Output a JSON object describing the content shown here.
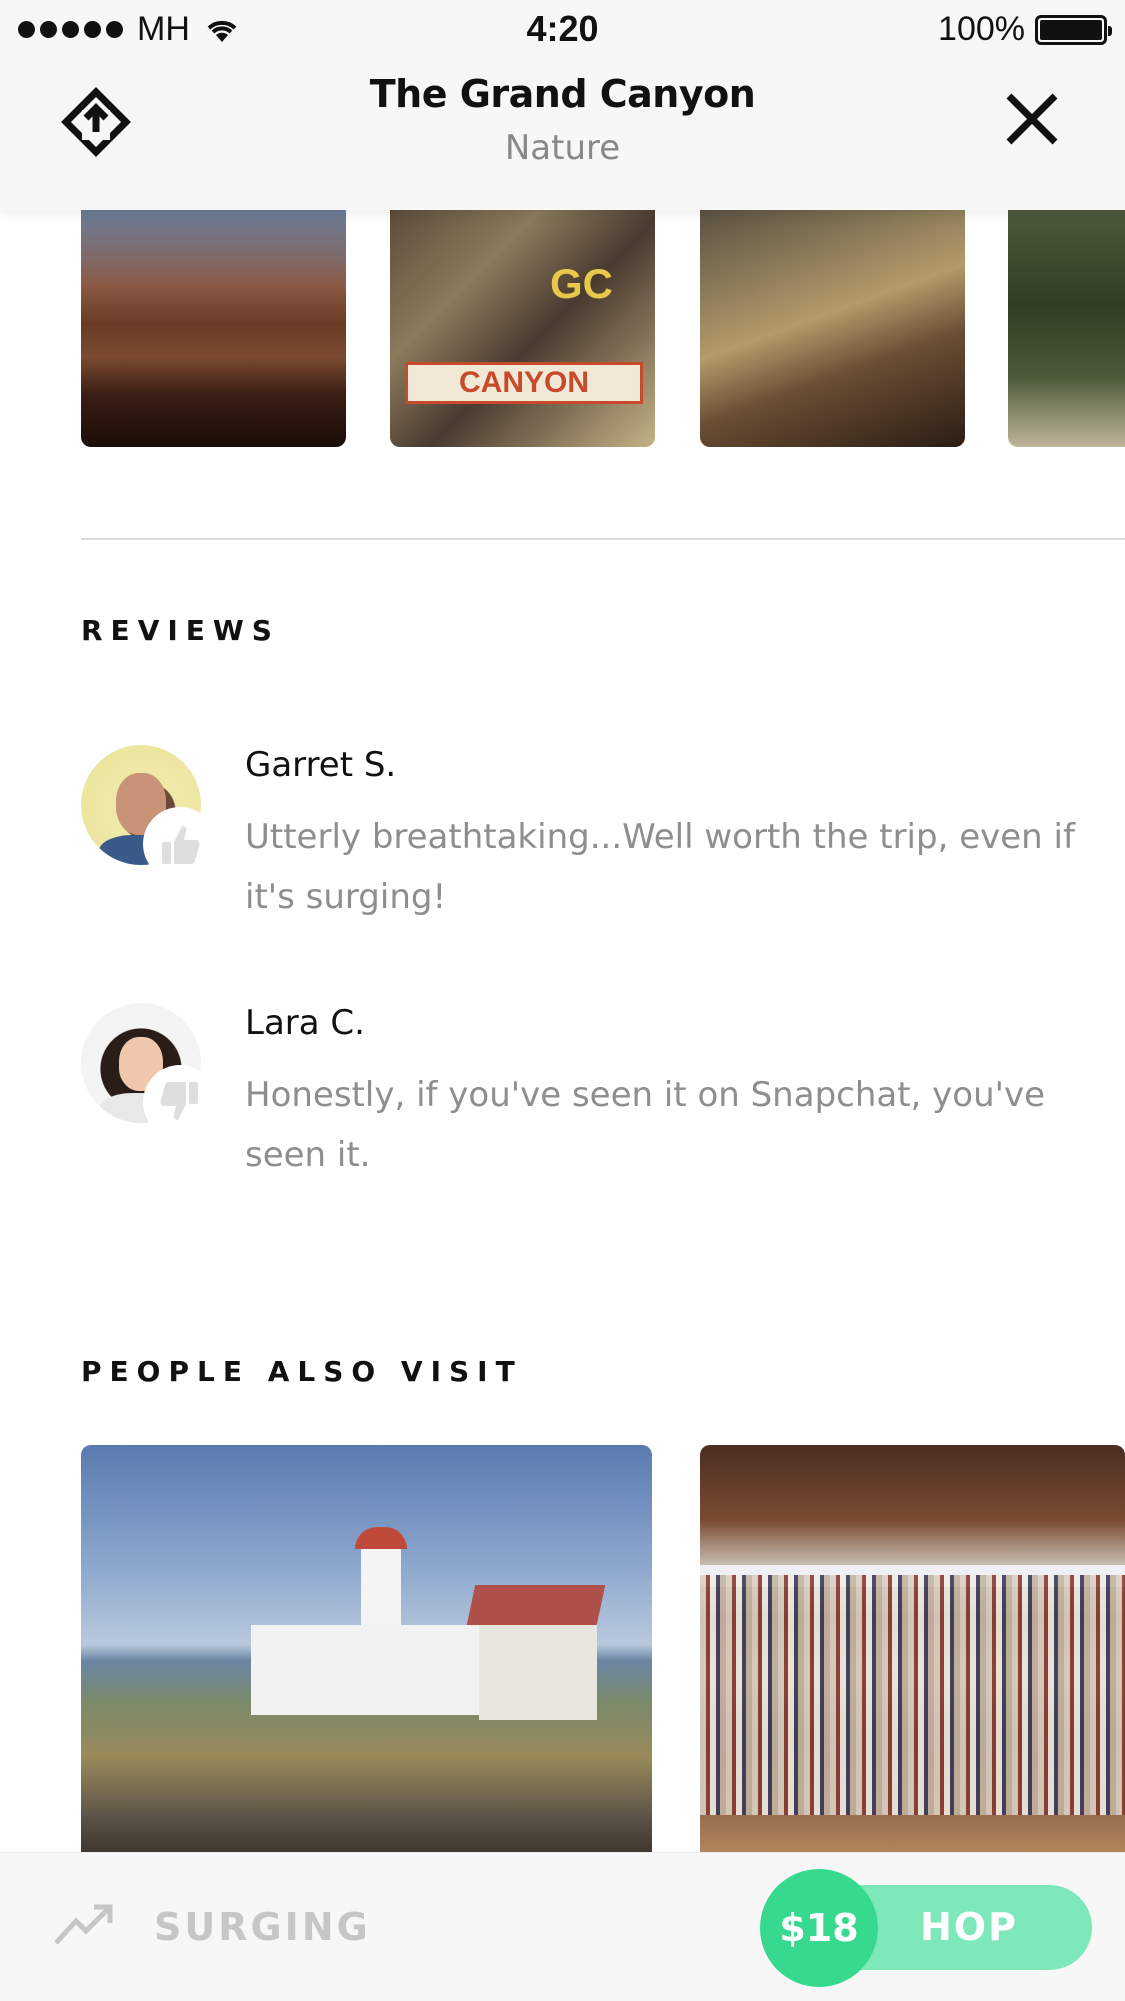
{
  "status_bar": {
    "carrier": "MH",
    "time": "4:20",
    "battery": "100%",
    "battery_level": 1.0
  },
  "header": {
    "title": "The Grand Canyon",
    "subtitle": "Nature",
    "share_icon": "share-icon",
    "close_icon": "close-icon"
  },
  "photos": {
    "poster_text": "CANYON",
    "poster_badge": "GC"
  },
  "reviews": {
    "heading": "REVIEWS",
    "items": [
      {
        "name": "Garret S.",
        "text": "Utterly breathtaking...Well worth the trip, even if it's surging!",
        "rating": "thumbs-up"
      },
      {
        "name": "Lara C.",
        "text": "Honestly, if you've seen it on Snapchat, you've seen it.",
        "rating": "thumbs-down"
      }
    ]
  },
  "also_visit": {
    "heading": "PEOPLE ALSO VISIT"
  },
  "bottom_bar": {
    "surging_label": "SURGING",
    "price": "$18",
    "hop_label": "HOP",
    "accent_color": "#37d98e",
    "pill_color": "#7ee8bb"
  }
}
